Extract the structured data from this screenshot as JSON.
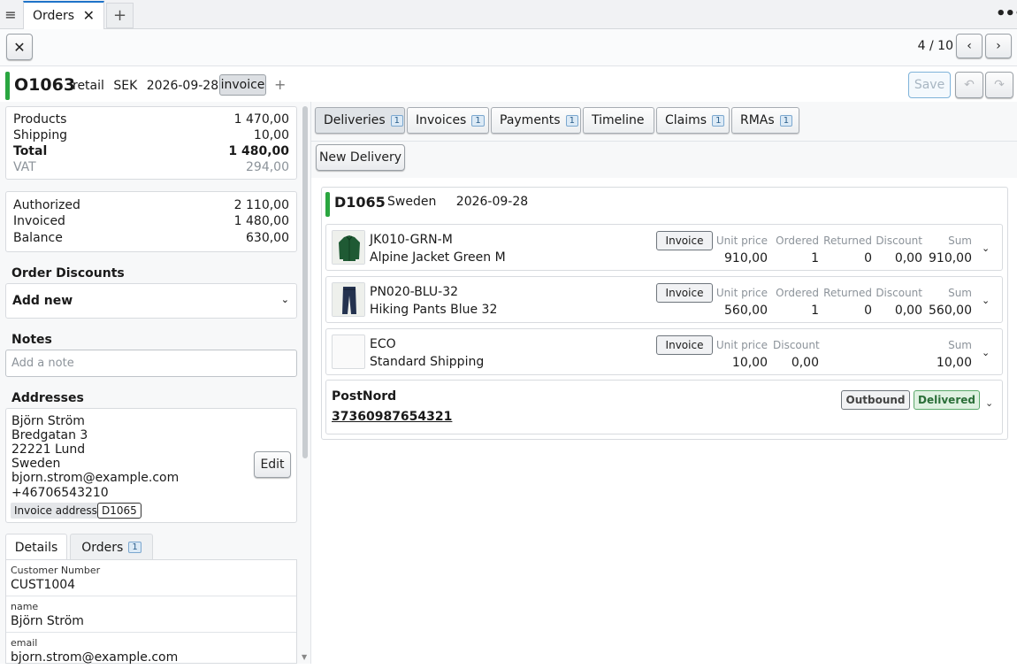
{
  "tabs": {
    "active_label": "Orders",
    "close_glyph": "✕",
    "add_glyph": "+"
  },
  "menu_glyph": "≡",
  "more_glyph": "•••",
  "toolbar": {
    "close_glyph": "✕",
    "pager": "4 / 10",
    "prev_glyph": "‹",
    "next_glyph": "›"
  },
  "order": {
    "id": "O1063",
    "channel": "retail",
    "currency": "SEK",
    "date": "2026-09-28",
    "badge": "invoice",
    "add_glyph": "+",
    "save_label": "Save",
    "undo_glyph": "↶",
    "redo_glyph": "↷"
  },
  "totals": [
    {
      "label": "Products",
      "value": "1 470,00"
    },
    {
      "label": "Shipping",
      "value": "10,00"
    },
    {
      "label": "Total",
      "value": "1 480,00"
    },
    {
      "label": "VAT",
      "value": "294,00"
    }
  ],
  "payment_summary": [
    {
      "label": "Authorized",
      "value": "2 110,00"
    },
    {
      "label": "Invoiced",
      "value": "1 480,00"
    },
    {
      "label": "Balance",
      "value": "630,00"
    }
  ],
  "discounts": {
    "title": "Order Discounts",
    "select_value": "Add new"
  },
  "notes": {
    "title": "Notes",
    "placeholder": "Add a note"
  },
  "addresses": {
    "title": "Addresses",
    "lines": [
      "Björn Ström",
      "Bredgatan 3",
      "22221 Lund",
      "Sweden",
      "bjorn.strom@example.com",
      "+46706543210"
    ],
    "edit_label": "Edit",
    "tag_type": "Invoice address",
    "tag_ref": "D1065"
  },
  "subtabs": {
    "details": "Details",
    "orders": "Orders",
    "orders_count": "1"
  },
  "details": [
    {
      "key": "Customer Number",
      "value": "CUST1004"
    },
    {
      "key": "name",
      "value": "Björn Ström"
    },
    {
      "key": "email",
      "value": "bjorn.strom@example.com"
    }
  ],
  "main_tabs": [
    {
      "label": "Deliveries",
      "count": "1"
    },
    {
      "label": "Invoices",
      "count": "1"
    },
    {
      "label": "Payments",
      "count": "1"
    },
    {
      "label": "Timeline",
      "count": ""
    },
    {
      "label": "Claims",
      "count": "1"
    },
    {
      "label": "RMAs",
      "count": "1"
    }
  ],
  "new_delivery_label": "New Delivery",
  "delivery": {
    "id": "D1065",
    "country": "Sweden",
    "date": "2026-09-28",
    "lines": [
      {
        "sku": "JK010-GRN-M",
        "name": "Alpine Jacket Green M",
        "invoice": "Invoice",
        "unit_price": "910,00",
        "ordered": "1",
        "returned": "0",
        "discount": "0,00",
        "sum": "910,00"
      },
      {
        "sku": "PN020-BLU-32",
        "name": "Hiking Pants Blue 32",
        "invoice": "Invoice",
        "unit_price": "560,00",
        "ordered": "1",
        "returned": "0",
        "discount": "0,00",
        "sum": "560,00"
      },
      {
        "sku": "ECO",
        "name": "Standard Shipping",
        "invoice": "Invoice",
        "unit_price": "10,00",
        "discount": "0,00",
        "sum": "10,00"
      }
    ],
    "headers": {
      "unit_price": "Unit price",
      "ordered": "Ordered",
      "returned": "Returned",
      "discount": "Discount",
      "sum": "Sum"
    },
    "carrier": {
      "name": "PostNord",
      "tracking": "37360987654321",
      "direction": "Outbound",
      "status": "Delivered"
    }
  },
  "icons": {
    "chevron": "⌄"
  },
  "colors": {
    "accent_green": "#2aa640",
    "link_blue": "#1e73c8"
  }
}
